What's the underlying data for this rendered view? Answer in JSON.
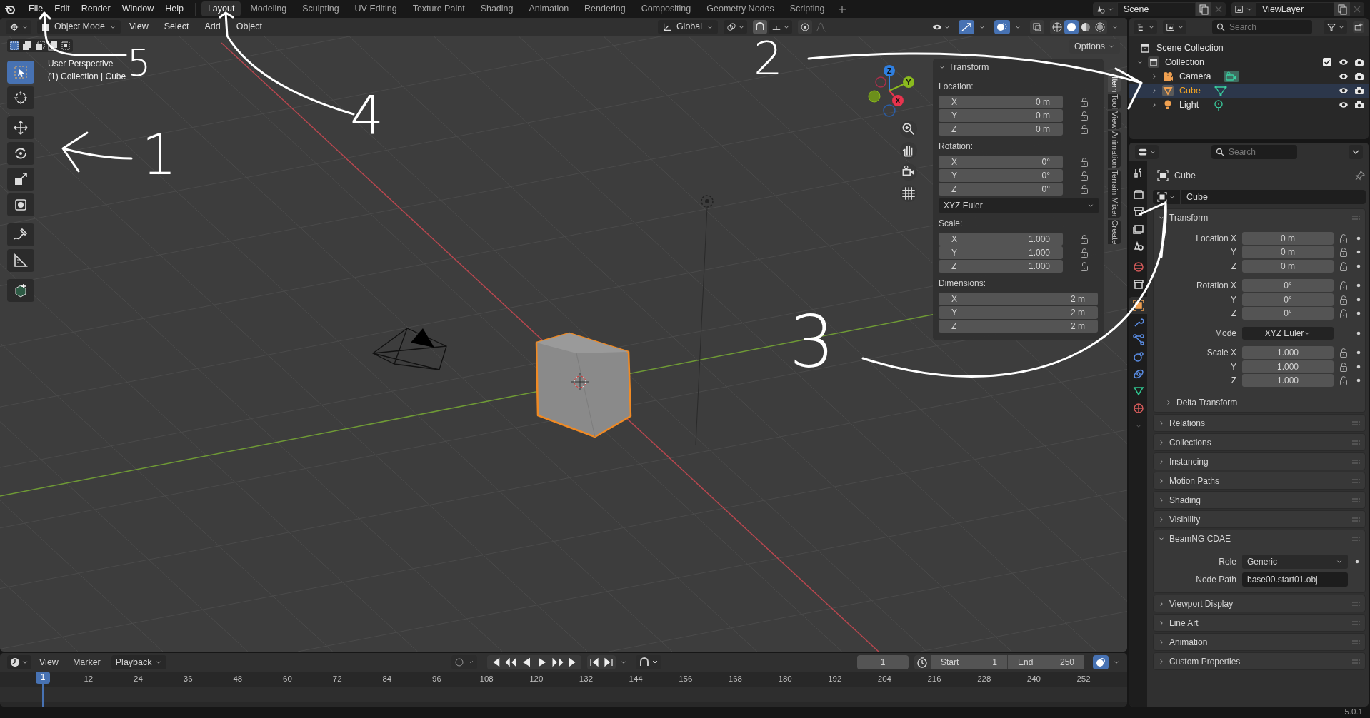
{
  "topbar": {
    "menus": [
      "File",
      "Edit",
      "Render",
      "Window",
      "Help"
    ],
    "workspaces": [
      {
        "label": "Layout",
        "selected": true
      },
      {
        "label": "Modeling",
        "selected": false
      },
      {
        "label": "Sculpting",
        "selected": false
      },
      {
        "label": "UV Editing",
        "selected": false
      },
      {
        "label": "Texture Paint",
        "selected": false
      },
      {
        "label": "Shading",
        "selected": false
      },
      {
        "label": "Animation",
        "selected": false
      },
      {
        "label": "Rendering",
        "selected": false
      },
      {
        "label": "Compositing",
        "selected": false
      },
      {
        "label": "Geometry Nodes",
        "selected": false
      },
      {
        "label": "Scripting",
        "selected": false
      }
    ],
    "scene": "Scene",
    "view_layer": "ViewLayer"
  },
  "viewport": {
    "mode": "Object Mode",
    "menus": [
      "View",
      "Select",
      "Add",
      "Object"
    ],
    "orientation": "Global",
    "options": "Options",
    "info": [
      "User Perspective",
      "(1) Collection | Cube"
    ],
    "tools": [
      {
        "kind": "select_box",
        "selected": true
      },
      {
        "kind": "cursor",
        "selected": false
      },
      {
        "kind": "move",
        "selected": false
      },
      {
        "kind": "rotate",
        "selected": false
      },
      {
        "kind": "scale",
        "selected": false
      },
      {
        "kind": "transform",
        "selected": false
      },
      {
        "kind": "annotate",
        "selected": false
      },
      {
        "kind": "measure",
        "selected": false
      },
      {
        "kind": "add_cube",
        "selected": false
      }
    ],
    "gizmo_axes": [
      "X",
      "Y",
      "Z"
    ],
    "sidebar_tabs": [
      {
        "label": "Item",
        "selected": true
      },
      {
        "label": "Tool",
        "selected": false
      },
      {
        "label": "View",
        "selected": false
      },
      {
        "label": "Animation",
        "selected": false
      },
      {
        "label": "Terrain Mixer",
        "selected": false
      },
      {
        "label": "Create",
        "selected": false
      }
    ],
    "transform": {
      "title": "Transform",
      "groups": [
        {
          "kind": "fields",
          "label": "Location:",
          "lockable": true,
          "rows": [
            {
              "axis": "X",
              "value": "0 m"
            },
            {
              "axis": "Y",
              "value": "0 m"
            },
            {
              "axis": "Z",
              "value": "0 m"
            }
          ]
        },
        {
          "kind": "fields",
          "label": "Rotation:",
          "lockable": true,
          "rows": [
            {
              "axis": "X",
              "value": "0°"
            },
            {
              "axis": "Y",
              "value": "0°"
            },
            {
              "axis": "Z",
              "value": "0°"
            }
          ]
        },
        {
          "kind": "dropdown",
          "value": "XYZ Euler"
        },
        {
          "kind": "fields",
          "label": "Scale:",
          "lockable": true,
          "rows": [
            {
              "axis": "X",
              "value": "1.000"
            },
            {
              "axis": "Y",
              "value": "1.000"
            },
            {
              "axis": "Z",
              "value": "1.000"
            }
          ]
        },
        {
          "kind": "fields",
          "label": "Dimensions:",
          "lockable": false,
          "rows": [
            {
              "axis": "X",
              "value": "2 m"
            },
            {
              "axis": "Y",
              "value": "2 m"
            },
            {
              "axis": "Z",
              "value": "2 m"
            }
          ]
        }
      ]
    }
  },
  "outliner": {
    "search_placeholder": "Search",
    "tree": [
      {
        "label": "Scene Collection",
        "kind": "scene_collection",
        "children": [
          {
            "label": "Collection",
            "kind": "collection",
            "expanded": true,
            "checked": true,
            "children": [
              {
                "label": "Camera",
                "kind": "camera",
                "expanded": false,
                "selected": false
              },
              {
                "label": "Cube",
                "kind": "mesh",
                "expanded": false,
                "selected": true
              },
              {
                "label": "Light",
                "kind": "light",
                "expanded": false,
                "selected": false
              }
            ]
          }
        ]
      }
    ]
  },
  "properties": {
    "search_placeholder": "Search",
    "tabs": [
      {
        "kind": "tool",
        "selected": false
      },
      {
        "kind": "render",
        "selected": false
      },
      {
        "kind": "output",
        "selected": false
      },
      {
        "kind": "view_layer",
        "selected": false
      },
      {
        "kind": "scene",
        "selected": false
      },
      {
        "kind": "world",
        "selected": false
      },
      {
        "kind": "collection",
        "selected": false
      },
      {
        "kind": "object",
        "selected": true
      },
      {
        "kind": "modifiers",
        "selected": false
      },
      {
        "kind": "particles",
        "selected": false
      },
      {
        "kind": "physics",
        "selected": false
      },
      {
        "kind": "constraints",
        "selected": false
      },
      {
        "kind": "data",
        "selected": false
      },
      {
        "kind": "material",
        "selected": false
      }
    ],
    "object_name": "Cube",
    "datablock": "Cube",
    "panels": [
      {
        "kind": "transform",
        "label": "Transform",
        "expanded": true,
        "groups": [
          {
            "rows": [
              {
                "kind": "number",
                "label": "Location X",
                "value": "0 m"
              },
              {
                "kind": "number",
                "label": "Y",
                "value": "0 m"
              },
              {
                "kind": "number",
                "label": "Z",
                "value": "0 m"
              }
            ]
          },
          {
            "rows": [
              {
                "kind": "number",
                "label": "Rotation X",
                "value": "0°"
              },
              {
                "kind": "number",
                "label": "Y",
                "value": "0°"
              },
              {
                "kind": "number",
                "label": "Z",
                "value": "0°"
              }
            ]
          },
          {
            "rows": [
              {
                "kind": "dropdown",
                "label": "Mode",
                "value": "XYZ Euler"
              }
            ]
          },
          {
            "rows": [
              {
                "kind": "number",
                "label": "Scale X",
                "value": "1.000"
              },
              {
                "kind": "number",
                "label": "Y",
                "value": "1.000"
              },
              {
                "kind": "number",
                "label": "Z",
                "value": "1.000"
              }
            ]
          }
        ],
        "subpanels": [
          {
            "label": "Delta Transform",
            "expanded": false
          }
        ]
      },
      {
        "kind": "plain",
        "label": "Relations",
        "expanded": false
      },
      {
        "kind": "plain",
        "label": "Collections",
        "expanded": false
      },
      {
        "kind": "plain",
        "label": "Instancing",
        "expanded": false
      },
      {
        "kind": "plain",
        "label": "Motion Paths",
        "expanded": false
      },
      {
        "kind": "plain",
        "label": "Shading",
        "expanded": false
      },
      {
        "kind": "plain",
        "label": "Visibility",
        "expanded": false
      },
      {
        "kind": "form",
        "label": "BeamNG CDAE",
        "expanded": true,
        "fields": [
          {
            "kind": "dropdown",
            "label": "Role",
            "value": "Generic"
          },
          {
            "kind": "text",
            "label": "Node Path",
            "value": "base00.start01.obj"
          }
        ]
      },
      {
        "kind": "plain",
        "label": "Viewport Display",
        "expanded": false
      },
      {
        "kind": "plain",
        "label": "Line Art",
        "expanded": false
      },
      {
        "kind": "plain",
        "label": "Animation",
        "expanded": false
      },
      {
        "kind": "plain",
        "label": "Custom Properties",
        "expanded": false
      }
    ]
  },
  "timeline": {
    "menus": [
      "View",
      "Marker",
      "Playback"
    ],
    "current_frame": "1",
    "start_label": "Start",
    "start": "1",
    "end_label": "End",
    "end": "250",
    "playhead": "1",
    "ticks": [
      "12",
      "24",
      "36",
      "48",
      "60",
      "72",
      "84",
      "96",
      "108",
      "120",
      "132",
      "144",
      "156",
      "168",
      "180",
      "192",
      "204",
      "216",
      "228",
      "240",
      "252"
    ]
  },
  "status": {
    "version": "5.0.1"
  },
  "annotations": [
    {
      "text": "5"
    },
    {
      "text": "4"
    },
    {
      "text": "1"
    },
    {
      "text": "2"
    },
    {
      "text": "3"
    }
  ]
}
